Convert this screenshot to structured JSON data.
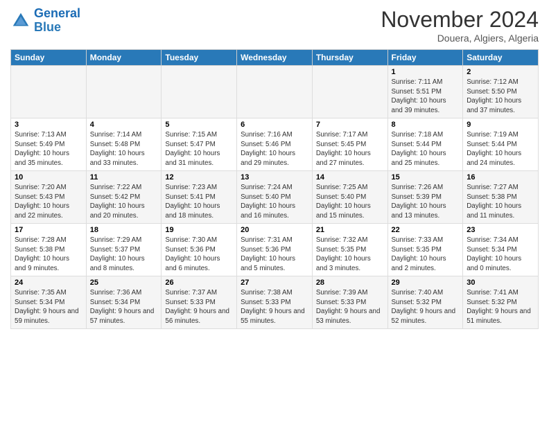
{
  "header": {
    "logo_line1": "General",
    "logo_line2": "Blue",
    "month": "November 2024",
    "location": "Douera, Algiers, Algeria"
  },
  "weekdays": [
    "Sunday",
    "Monday",
    "Tuesday",
    "Wednesday",
    "Thursday",
    "Friday",
    "Saturday"
  ],
  "weeks": [
    [
      {
        "day": "",
        "info": ""
      },
      {
        "day": "",
        "info": ""
      },
      {
        "day": "",
        "info": ""
      },
      {
        "day": "",
        "info": ""
      },
      {
        "day": "",
        "info": ""
      },
      {
        "day": "1",
        "info": "Sunrise: 7:11 AM\nSunset: 5:51 PM\nDaylight: 10 hours and 39 minutes."
      },
      {
        "day": "2",
        "info": "Sunrise: 7:12 AM\nSunset: 5:50 PM\nDaylight: 10 hours and 37 minutes."
      }
    ],
    [
      {
        "day": "3",
        "info": "Sunrise: 7:13 AM\nSunset: 5:49 PM\nDaylight: 10 hours and 35 minutes."
      },
      {
        "day": "4",
        "info": "Sunrise: 7:14 AM\nSunset: 5:48 PM\nDaylight: 10 hours and 33 minutes."
      },
      {
        "day": "5",
        "info": "Sunrise: 7:15 AM\nSunset: 5:47 PM\nDaylight: 10 hours and 31 minutes."
      },
      {
        "day": "6",
        "info": "Sunrise: 7:16 AM\nSunset: 5:46 PM\nDaylight: 10 hours and 29 minutes."
      },
      {
        "day": "7",
        "info": "Sunrise: 7:17 AM\nSunset: 5:45 PM\nDaylight: 10 hours and 27 minutes."
      },
      {
        "day": "8",
        "info": "Sunrise: 7:18 AM\nSunset: 5:44 PM\nDaylight: 10 hours and 25 minutes."
      },
      {
        "day": "9",
        "info": "Sunrise: 7:19 AM\nSunset: 5:44 PM\nDaylight: 10 hours and 24 minutes."
      }
    ],
    [
      {
        "day": "10",
        "info": "Sunrise: 7:20 AM\nSunset: 5:43 PM\nDaylight: 10 hours and 22 minutes."
      },
      {
        "day": "11",
        "info": "Sunrise: 7:22 AM\nSunset: 5:42 PM\nDaylight: 10 hours and 20 minutes."
      },
      {
        "day": "12",
        "info": "Sunrise: 7:23 AM\nSunset: 5:41 PM\nDaylight: 10 hours and 18 minutes."
      },
      {
        "day": "13",
        "info": "Sunrise: 7:24 AM\nSunset: 5:40 PM\nDaylight: 10 hours and 16 minutes."
      },
      {
        "day": "14",
        "info": "Sunrise: 7:25 AM\nSunset: 5:40 PM\nDaylight: 10 hours and 15 minutes."
      },
      {
        "day": "15",
        "info": "Sunrise: 7:26 AM\nSunset: 5:39 PM\nDaylight: 10 hours and 13 minutes."
      },
      {
        "day": "16",
        "info": "Sunrise: 7:27 AM\nSunset: 5:38 PM\nDaylight: 10 hours and 11 minutes."
      }
    ],
    [
      {
        "day": "17",
        "info": "Sunrise: 7:28 AM\nSunset: 5:38 PM\nDaylight: 10 hours and 9 minutes."
      },
      {
        "day": "18",
        "info": "Sunrise: 7:29 AM\nSunset: 5:37 PM\nDaylight: 10 hours and 8 minutes."
      },
      {
        "day": "19",
        "info": "Sunrise: 7:30 AM\nSunset: 5:36 PM\nDaylight: 10 hours and 6 minutes."
      },
      {
        "day": "20",
        "info": "Sunrise: 7:31 AM\nSunset: 5:36 PM\nDaylight: 10 hours and 5 minutes."
      },
      {
        "day": "21",
        "info": "Sunrise: 7:32 AM\nSunset: 5:35 PM\nDaylight: 10 hours and 3 minutes."
      },
      {
        "day": "22",
        "info": "Sunrise: 7:33 AM\nSunset: 5:35 PM\nDaylight: 10 hours and 2 minutes."
      },
      {
        "day": "23",
        "info": "Sunrise: 7:34 AM\nSunset: 5:34 PM\nDaylight: 10 hours and 0 minutes."
      }
    ],
    [
      {
        "day": "24",
        "info": "Sunrise: 7:35 AM\nSunset: 5:34 PM\nDaylight: 9 hours and 59 minutes."
      },
      {
        "day": "25",
        "info": "Sunrise: 7:36 AM\nSunset: 5:34 PM\nDaylight: 9 hours and 57 minutes."
      },
      {
        "day": "26",
        "info": "Sunrise: 7:37 AM\nSunset: 5:33 PM\nDaylight: 9 hours and 56 minutes."
      },
      {
        "day": "27",
        "info": "Sunrise: 7:38 AM\nSunset: 5:33 PM\nDaylight: 9 hours and 55 minutes."
      },
      {
        "day": "28",
        "info": "Sunrise: 7:39 AM\nSunset: 5:33 PM\nDaylight: 9 hours and 53 minutes."
      },
      {
        "day": "29",
        "info": "Sunrise: 7:40 AM\nSunset: 5:32 PM\nDaylight: 9 hours and 52 minutes."
      },
      {
        "day": "30",
        "info": "Sunrise: 7:41 AM\nSunset: 5:32 PM\nDaylight: 9 hours and 51 minutes."
      }
    ]
  ]
}
